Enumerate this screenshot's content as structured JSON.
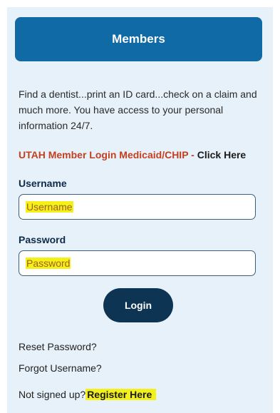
{
  "members_button": {
    "label": "Members"
  },
  "intro_text": "Find a dentist...print an ID card...check on a claim and much more. You have access to your personal information 24/7.",
  "utah_login": {
    "prefix": "UTAH Member Login Medicaid/CHIP",
    "separator": " - ",
    "link_label": "Click Here"
  },
  "username": {
    "label": "Username",
    "placeholder": "Username"
  },
  "password": {
    "label": "Password",
    "placeholder": "Password"
  },
  "login_button": {
    "label": "Login"
  },
  "links": {
    "reset_password": "Reset Password?",
    "forgot_username": "Forgot Username?"
  },
  "signup": {
    "prompt": "Not signed up?",
    "register_label": "Register Here"
  },
  "colors": {
    "panel_background": "#e7f1f9",
    "header_button": "#0f6aa6",
    "login_button": "#0e3453",
    "utah_text": "#c2401f",
    "highlight": "#f4f11a"
  }
}
